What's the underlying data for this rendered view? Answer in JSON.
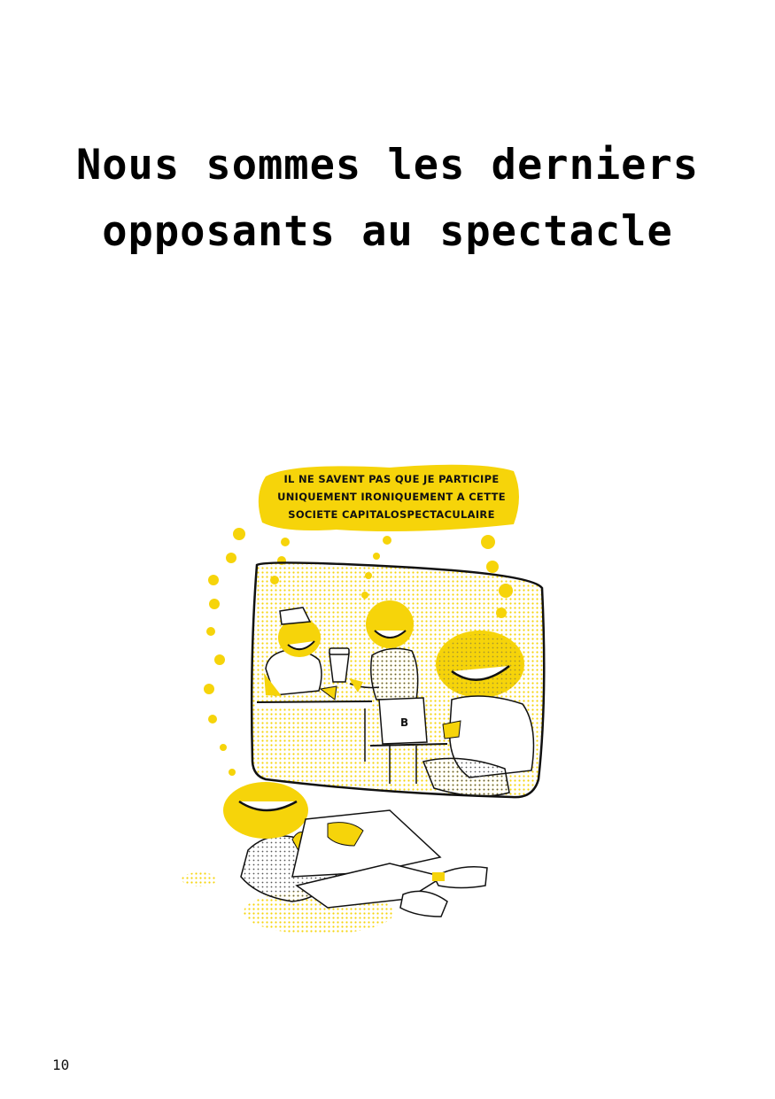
{
  "page": {
    "title_lines": [
      "Nous sommes les derniers",
      "opposants au spectacle"
    ],
    "page_number": "10"
  },
  "illustration": {
    "speech_bubble_lines": [
      "IL NE SAVENT PAS QUE JE PARTICIPE",
      "UNIQUEMENT IRONIQUEMENT A CETTE",
      "SOCIETE CAPITALOSPECTACULAIRE"
    ],
    "laptop_logo": "B",
    "colors": {
      "accent": "#f6d40a",
      "ink": "#111111"
    }
  }
}
